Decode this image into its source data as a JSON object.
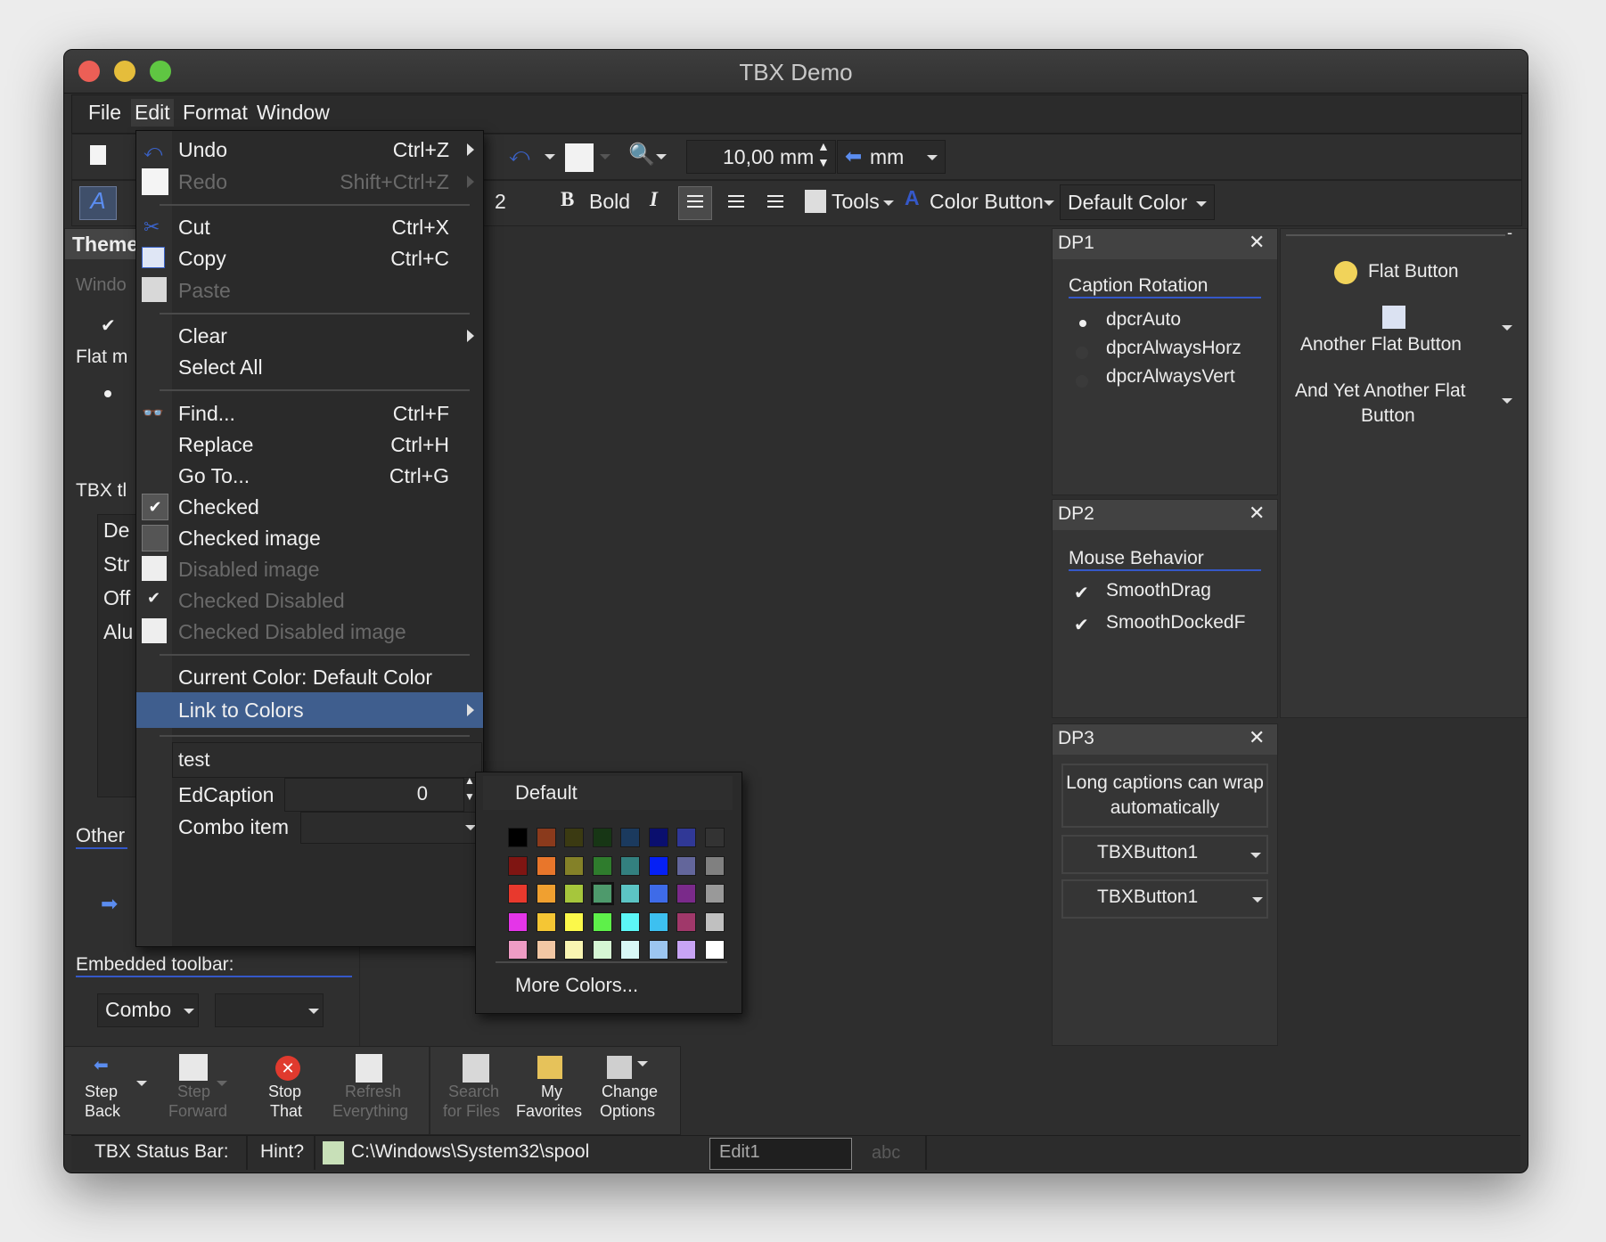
{
  "window": {
    "title": "TBX Demo"
  },
  "menubar": {
    "file": "File",
    "edit": "Edit",
    "format": "Format",
    "window": "Window"
  },
  "toolbar1": {
    "size_value": "10,00 mm",
    "unit": "mm"
  },
  "toolbar2": {
    "font_size": "2",
    "bold": "Bold",
    "tools": "Tools",
    "color_button": "Color Button",
    "default_color": "Default Color"
  },
  "left_panel": {
    "theme": "Theme",
    "window_label": "Windo",
    "flat_label": "Flat m",
    "tbx_label": "TBX tl",
    "list_items": [
      "De",
      "Str",
      "Off",
      "Alu"
    ],
    "other": "Other",
    "embedded_toolbar": "Embedded toolbar:",
    "combo": "Combo"
  },
  "edit_menu": {
    "undo": "Undo",
    "undo_sc": "Ctrl+Z",
    "redo": "Redo",
    "redo_sc": "Shift+Ctrl+Z",
    "cut": "Cut",
    "cut_sc": "Ctrl+X",
    "copy": "Copy",
    "copy_sc": "Ctrl+C",
    "paste": "Paste",
    "clear": "Clear",
    "select_all": "Select All",
    "find": "Find...",
    "find_sc": "Ctrl+F",
    "replace": "Replace",
    "replace_sc": "Ctrl+H",
    "goto": "Go To...",
    "goto_sc": "Ctrl+G",
    "checked": "Checked",
    "checked_image": "Checked image",
    "disabled_image": "Disabled image",
    "checked_disabled": "Checked Disabled",
    "checked_disabled_image": "Checked Disabled image",
    "current_color": "Current Color: Default Color",
    "link_to_colors": "Link to Colors",
    "edit_value": "test",
    "edcaption": "EdCaption",
    "edcaption_value": "0",
    "combo_item": "Combo item"
  },
  "colors_submenu": {
    "default": "Default",
    "more": "More Colors...",
    "palette": [
      [
        "#000000",
        "#8a3a1c",
        "#3b3a12",
        "#173615",
        "#1b3a5e",
        "#0a0f6e",
        "#303896",
        "#333333"
      ],
      [
        "#7f1512",
        "#e8762b",
        "#848128",
        "#2f7c2d",
        "#33807f",
        "#0520f5",
        "#63669b",
        "#808080"
      ],
      [
        "#e8392d",
        "#f0a030",
        "#a6c63c",
        "#4e9a6c",
        "#5cc4c4",
        "#3e6be8",
        "#7a2a8a",
        "#999999"
      ],
      [
        "#e435e8",
        "#f5c634",
        "#fbf84a",
        "#5ef04a",
        "#5cf6f6",
        "#3dc0f0",
        "#a0386a",
        "#c0c0c0"
      ],
      [
        "#ee9cc4",
        "#f2c7a4",
        "#f9f5b2",
        "#d6f7d4",
        "#d8f8f6",
        "#9cc6f0",
        "#c8a4f4",
        "#ffffff"
      ]
    ]
  },
  "dp1": {
    "title": "DP1",
    "caption": "Caption Rotation",
    "options": [
      "dpcrAuto",
      "dpcrAlwaysHorz",
      "dpcrAlwaysVert"
    ]
  },
  "dp2": {
    "title": "DP2",
    "caption": "Mouse Behavior",
    "options": [
      "SmoothDrag",
      "SmoothDockedF"
    ]
  },
  "dp3": {
    "title": "DP3",
    "long_caption": "Long captions can wrap automatically",
    "button1": "TBXButton1",
    "button2": "TBXButton1"
  },
  "right_panel": {
    "flat": "Flat Button",
    "another": "Another Flat Button",
    "yet_another_1": "And Yet Another Flat",
    "yet_another_2": "Button"
  },
  "bottom_toolbar": {
    "step_back_1": "Step",
    "step_back_2": "Back",
    "step_fwd_1": "Step",
    "step_fwd_2": "Forward",
    "stop_1": "Stop",
    "stop_2": "That",
    "refresh_1": "Refresh",
    "refresh_2": "Everything",
    "search_1": "Search",
    "search_2": "for Files",
    "fav_1": "My",
    "fav_2": "Favorites",
    "opts_1": "Change",
    "opts_2": "Options"
  },
  "statusbar": {
    "label": "TBX Status Bar:",
    "hint": "Hint?",
    "path": "C:\\Windows\\System32\\spool",
    "edit": "Edit1",
    "abc": "abc"
  }
}
